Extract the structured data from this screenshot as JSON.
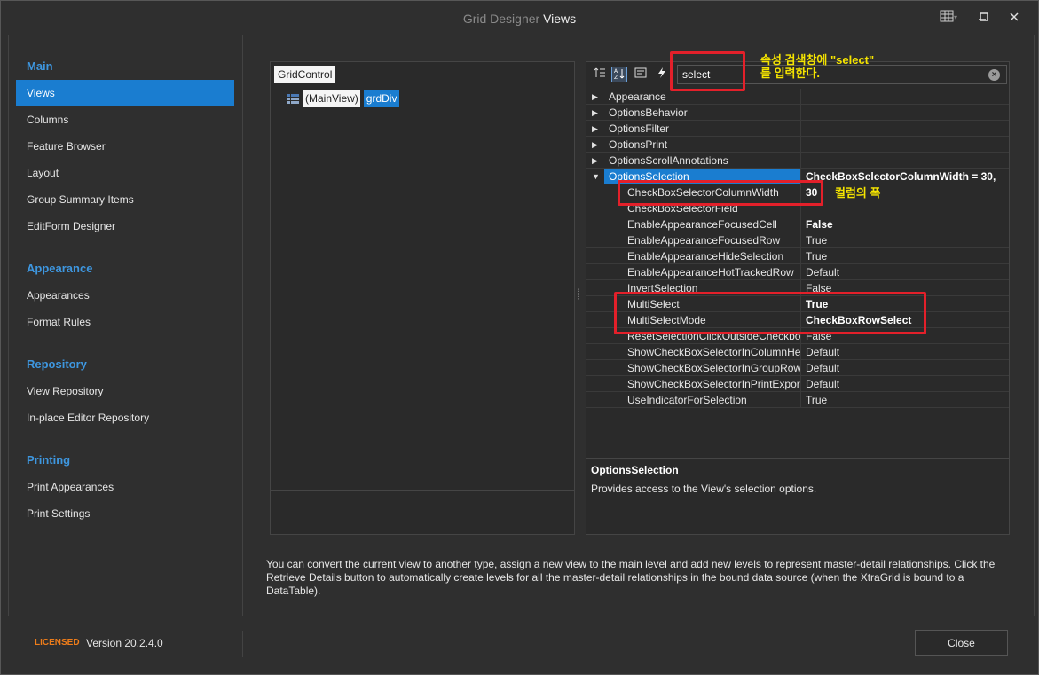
{
  "window": {
    "title_prefix": "Grid Designer",
    "title_accent": "Views"
  },
  "nav": {
    "sections": [
      {
        "header": "Main",
        "items": [
          "Views",
          "Columns",
          "Feature Browser",
          "Layout",
          "Group Summary Items",
          "EditForm Designer"
        ]
      },
      {
        "header": "Appearance",
        "items": [
          "Appearances",
          "Format Rules"
        ]
      },
      {
        "header": "Repository",
        "items": [
          "View Repository",
          "In-place Editor Repository"
        ]
      },
      {
        "header": "Printing",
        "items": [
          "Print Appearances",
          "Print Settings"
        ]
      }
    ],
    "active_item": "Views"
  },
  "tree": {
    "root": "GridControl",
    "child": "(MainView)",
    "child_name": "grdDiv"
  },
  "properties": {
    "search_value": "select",
    "rows": [
      {
        "name": "Appearance",
        "value": "",
        "level": 0,
        "expander": "right"
      },
      {
        "name": "OptionsBehavior",
        "value": "",
        "level": 0,
        "expander": "right"
      },
      {
        "name": "OptionsFilter",
        "value": "",
        "level": 0,
        "expander": "right"
      },
      {
        "name": "OptionsPrint",
        "value": "",
        "level": 0,
        "expander": "right"
      },
      {
        "name": "OptionsScrollAnnotations",
        "value": "",
        "level": 0,
        "expander": "right"
      },
      {
        "name": "OptionsSelection",
        "value": "CheckBoxSelectorColumnWidth = 30,",
        "level": 0,
        "expander": "down",
        "selected": true,
        "bold": true
      },
      {
        "name": "CheckBoxSelectorColumnWidth",
        "value": "30",
        "level": 1,
        "bold": true
      },
      {
        "name": "CheckBoxSelectorField",
        "value": "",
        "level": 1
      },
      {
        "name": "EnableAppearanceFocusedCell",
        "value": "False",
        "level": 1,
        "bold": true
      },
      {
        "name": "EnableAppearanceFocusedRow",
        "value": "True",
        "level": 1
      },
      {
        "name": "EnableAppearanceHideSelection",
        "value": "True",
        "level": 1
      },
      {
        "name": "EnableAppearanceHotTrackedRow",
        "value": "Default",
        "level": 1
      },
      {
        "name": "InvertSelection",
        "value": "False",
        "level": 1
      },
      {
        "name": "MultiSelect",
        "value": "True",
        "level": 1,
        "bold": true
      },
      {
        "name": "MultiSelectMode",
        "value": "CheckBoxRowSelect",
        "level": 1,
        "bold": true
      },
      {
        "name": "ResetSelectionClickOutsideCheckboxSelector",
        "value": "False",
        "level": 1
      },
      {
        "name": "ShowCheckBoxSelectorInColumnHeader",
        "value": "Default",
        "level": 1
      },
      {
        "name": "ShowCheckBoxSelectorInGroupRow",
        "value": "Default",
        "level": 1
      },
      {
        "name": "ShowCheckBoxSelectorInPrintExport",
        "value": "Default",
        "level": 1
      },
      {
        "name": "UseIndicatorForSelection",
        "value": "True",
        "level": 1
      }
    ],
    "description_title": "OptionsSelection",
    "description_text": "Provides access to the View's selection options."
  },
  "annotations": {
    "search_note_line1": "속성 검색창에 \"select\"",
    "search_note_line2": "를 입력한다.",
    "width_note": "컬럼의 폭"
  },
  "info_text": "You can convert the current view to another type, assign a new view to the main level and add new levels to represent master-detail relationships. Click the Retrieve Details button to automatically create levels for all the master-detail relationships in the bound data source (when the XtraGrid is bound to a DataTable).",
  "footer": {
    "licensed": "LICENSED",
    "version": "Version 20.2.4.0",
    "close_label": "Close"
  },
  "colors": {
    "accent": "#1a7dd0",
    "nav_header": "#3e97e0",
    "annotation_box": "#e3202a",
    "annotation_text": "#f5e400",
    "licensed": "#ef7d1a"
  }
}
